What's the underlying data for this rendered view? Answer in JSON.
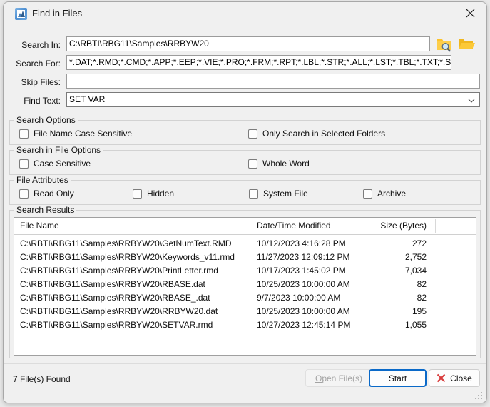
{
  "window": {
    "title": "Find in Files",
    "icon": "find-in-files-icon",
    "close_icon": "close-icon"
  },
  "form": {
    "fields": [
      {
        "label": "Search In:",
        "value": "C:\\RBTI\\RBG11\\Samples\\RRBYW20",
        "placeholder": "",
        "type": "text"
      },
      {
        "label": "Search For:",
        "value": "*.DAT;*.RMD;*.CMD;*.APP;*.EEP;*.VIE;*.PRO;*.FRM;*.RPT;*.LBL;*.STR;*.ALL;*.LST;*.TBL;*.TXT;*.SQL",
        "placeholder": "",
        "type": "text"
      },
      {
        "label": "Skip Files:",
        "value": "",
        "placeholder": "",
        "type": "text"
      },
      {
        "label": "Find Text:",
        "value": "SET VAR",
        "placeholder": "",
        "type": "combo"
      }
    ],
    "browse_folder_icon": "folder-search-icon",
    "open_folder_icon": "folder-open-icon"
  },
  "groups": [
    {
      "title": "Search Options",
      "checkboxes": [
        {
          "label": "File Name Case Sensitive",
          "checked": false
        },
        {
          "label": "Only Search in Selected Folders",
          "checked": false
        }
      ]
    },
    {
      "title": "Search in File Options",
      "checkboxes": [
        {
          "label": "Case Sensitive",
          "checked": false
        },
        {
          "label": "Whole Word",
          "checked": false
        }
      ]
    },
    {
      "title": "File Attributes",
      "checkboxes": [
        {
          "label": "Read Only",
          "checked": false
        },
        {
          "label": "Hidden",
          "checked": false
        },
        {
          "label": "System File",
          "checked": false
        },
        {
          "label": "Archive",
          "checked": false
        }
      ]
    }
  ],
  "results": {
    "group_title": "Search Results",
    "columns": [
      "File Name",
      "Date/Time Modified",
      "Size (Bytes)"
    ],
    "rows": [
      {
        "name": "C:\\RBTI\\RBG11\\Samples\\RRBYW20\\GetNumText.RMD",
        "modified": "10/12/2023 4:16:28 PM",
        "size": "272"
      },
      {
        "name": "C:\\RBTI\\RBG11\\Samples\\RRBYW20\\Keywords_v11.rmd",
        "modified": "11/27/2023 12:09:12 PM",
        "size": "2,752"
      },
      {
        "name": "C:\\RBTI\\RBG11\\Samples\\RRBYW20\\PrintLetter.rmd",
        "modified": "10/17/2023 1:45:02 PM",
        "size": "7,034"
      },
      {
        "name": "C:\\RBTI\\RBG11\\Samples\\RRBYW20\\RBASE.dat",
        "modified": "10/25/2023 10:00:00 AM",
        "size": "82"
      },
      {
        "name": "C:\\RBTI\\RBG11\\Samples\\RRBYW20\\RBASE_.dat",
        "modified": "9/7/2023 10:00:00 AM",
        "size": "82"
      },
      {
        "name": "C:\\RBTI\\RBG11\\Samples\\RRBYW20\\RRBYW20.dat",
        "modified": "10/25/2023 10:00:00 AM",
        "size": "195"
      },
      {
        "name": "C:\\RBTI\\RBG11\\Samples\\RRBYW20\\SETVAR.rmd",
        "modified": "10/27/2023 12:45:14 PM",
        "size": "1,055"
      }
    ]
  },
  "footer": {
    "status": "7 File(s) Found",
    "buttons": [
      {
        "label": "Open File(s)",
        "accel": "O",
        "state": "disabled"
      },
      {
        "label": "Start",
        "accel": "",
        "state": "focused"
      },
      {
        "label": "Close",
        "accel": "",
        "state": "normal",
        "icon": "red-x-icon"
      }
    ]
  },
  "colors": {
    "dialog_bg": "#f0f0f0",
    "field_bg": "#ffffff",
    "accent_focus": "#0a69c8",
    "close_x_red": "#d83b3b",
    "folder_yellow": "#fcc32c",
    "text": "#101010"
  }
}
